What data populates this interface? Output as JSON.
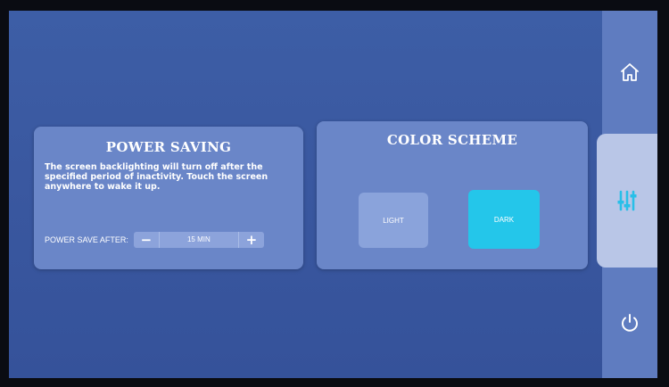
{
  "sidebar": {
    "home_icon": "home-icon",
    "settings_icon": "sliders-icon",
    "power_icon": "power-icon"
  },
  "power_saving": {
    "title": "POWER SAVING",
    "description": "The screen backlighting will turn off after the specified period of inactivity. Touch the screen anywhere to wake it up.",
    "label": "POWER SAVE AFTER:",
    "minus": "−",
    "value": "15 MIN",
    "plus": "+"
  },
  "color_scheme": {
    "title": "COLOR SCHEME",
    "options": [
      {
        "label": "LIGHT",
        "selected": false
      },
      {
        "label": "DARK",
        "selected": true
      }
    ]
  },
  "colors": {
    "background": "#3a58a0",
    "panel": "#6a86c8",
    "accent": "#24c6ea"
  }
}
